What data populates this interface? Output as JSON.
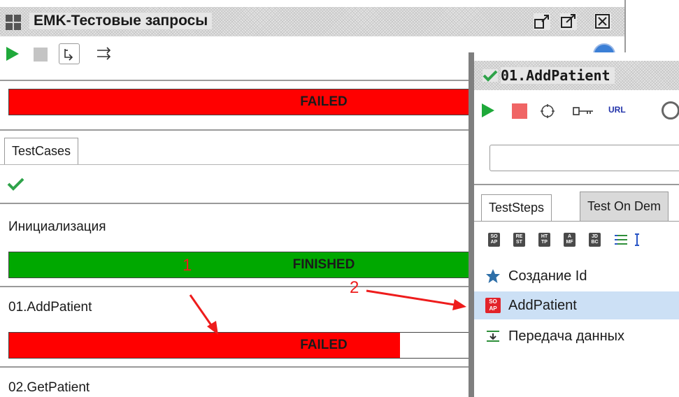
{
  "left_window": {
    "title": "EMK-Тестовые запросы",
    "overall_status": {
      "text": "FAILED",
      "color": "#ff0000"
    },
    "tab_label": "TestCases",
    "cases": [
      {
        "name": "Инициализация",
        "status": "FINISHED",
        "color": "#00a800",
        "progress": 1.0
      },
      {
        "name": "01.AddPatient",
        "status": "FAILED",
        "color": "#ff0000",
        "progress": 0.85
      },
      {
        "name": "02.GetPatient"
      }
    ]
  },
  "right_window": {
    "title": "01.AddPatient",
    "toolbar": {
      "url_label": "URL"
    },
    "tabs": [
      "TestSteps",
      "Test On Dem"
    ],
    "step_type_icons": [
      {
        "top": "SO",
        "bottom": "AP"
      },
      {
        "top": "RE",
        "bottom": "ST"
      },
      {
        "top": "HT",
        "bottom": "TP"
      },
      {
        "top": "A",
        "bottom": "MF"
      },
      {
        "top": "JD",
        "bottom": "BC"
      }
    ],
    "steps": [
      {
        "label": "Создание Id",
        "icon": "star-icon",
        "selected": false
      },
      {
        "label": "AddPatient",
        "icon": "soap-icon",
        "selected": true
      },
      {
        "label": "Передача данных",
        "icon": "transfer-icon",
        "selected": false
      }
    ]
  },
  "annotations": {
    "one": "1",
    "two": "2",
    "color": "#ee1c1c"
  }
}
